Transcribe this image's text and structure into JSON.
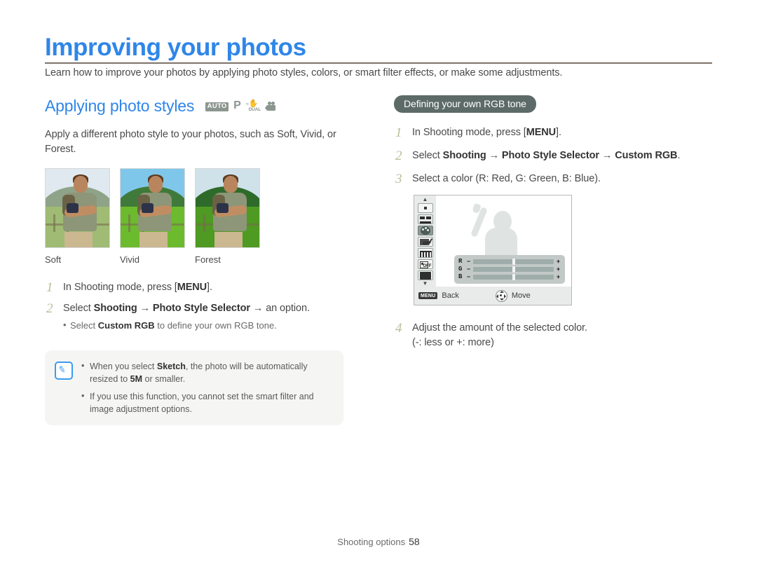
{
  "page": {
    "title": "Improving your photos",
    "intro": "Learn how to improve your photos by applying photo styles, colors, or smart filter effects, or make some adjustments.",
    "title_color": "#2f86e8",
    "rule_color": "#7d7369"
  },
  "left": {
    "section_title": "Applying photo styles",
    "mode_icons": [
      "auto-icon",
      "program-icon",
      "dual-is-icon",
      "movie-icon"
    ],
    "mode_auto_label": "AUTO",
    "mode_p_label": "P",
    "mode_dual_label": "DUAL",
    "body": "Apply a different photo style to your photos, such as Soft, Vivid, or Forest.",
    "samples": [
      {
        "label": "Soft"
      },
      {
        "label": "Vivid"
      },
      {
        "label": "Forest"
      }
    ],
    "steps": [
      {
        "num": "1",
        "parts": [
          {
            "t": "In Shooting mode, press [",
            "b": false
          },
          {
            "t": "MENU",
            "b": true
          },
          {
            "t": "].",
            "b": false
          }
        ]
      },
      {
        "num": "2",
        "parts": [
          {
            "t": "Select ",
            "b": false
          },
          {
            "t": "Shooting",
            "b": true
          },
          {
            "t": " → ",
            "b": false
          },
          {
            "t": "Photo Style Selector",
            "b": true
          },
          {
            "t": " → an option.",
            "b": false
          }
        ],
        "bullet": [
          {
            "t": "Select ",
            "b": false
          },
          {
            "t": "Custom RGB",
            "b": true
          },
          {
            "t": " to define your own RGB tone.",
            "b": false
          }
        ]
      }
    ],
    "note": {
      "icon": "note-pen-icon",
      "items": [
        [
          {
            "t": "When you select ",
            "b": false
          },
          {
            "t": "Sketch",
            "b": true
          },
          {
            "t": ", the photo will be automatically resized to ",
            "b": false
          },
          {
            "t": "5M",
            "b": true
          },
          {
            "t": " or smaller.",
            "b": false
          }
        ],
        [
          {
            "t": "If you use this function, you cannot set the smart filter and image adjustment options.",
            "b": false
          }
        ]
      ]
    }
  },
  "right": {
    "pill_label": "Defining your own RGB tone",
    "pill_bg": "#5d6b68",
    "steps": [
      {
        "num": "1",
        "parts": [
          {
            "t": "In Shooting mode, press [",
            "b": false
          },
          {
            "t": "MENU",
            "b": true
          },
          {
            "t": "].",
            "b": false
          }
        ]
      },
      {
        "num": "2",
        "parts": [
          {
            "t": "Select ",
            "b": false
          },
          {
            "t": "Shooting",
            "b": true
          },
          {
            "t": " → ",
            "b": false
          },
          {
            "t": "Photo Style Selector",
            "b": true
          },
          {
            "t": " → ",
            "b": false
          },
          {
            "t": "Custom RGB",
            "b": true
          },
          {
            "t": ".",
            "b": false
          }
        ]
      },
      {
        "num": "3",
        "parts": [
          {
            "t": "Select a color (R: Red, G: Green, B: Blue).",
            "b": false
          }
        ]
      }
    ],
    "lcd": {
      "side_icons": [
        "chevron-up-icon",
        "photo-size-icon",
        "quality-icon",
        "photo-style-selector-icon",
        "smart-filter-off-icon",
        "image-adjust-icon",
        "face-detection-off-icon",
        "frame-guide-icon",
        "chevron-down-icon"
      ],
      "off_label": "OFF",
      "selected_icon": "photo-style-selector-icon",
      "sliders": [
        {
          "label": "R",
          "minus": "−",
          "plus": "+",
          "value": 50
        },
        {
          "label": "G",
          "minus": "−",
          "plus": "+",
          "value": 50
        },
        {
          "label": "B",
          "minus": "−",
          "plus": "+",
          "value": 50
        }
      ],
      "bottom": {
        "menu_key": "MENU",
        "back_label": "Back",
        "move_label": "Move"
      }
    },
    "step4": {
      "num": "4",
      "line1": "Adjust the amount of the selected color.",
      "line2": "(-: less or +: more)"
    }
  },
  "footer": {
    "section": "Shooting options",
    "page_number": "58"
  }
}
